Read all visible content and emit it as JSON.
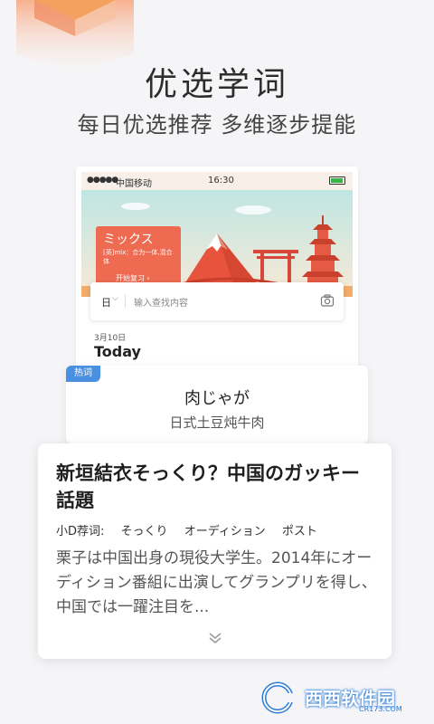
{
  "promo": {
    "headline": "优选学词",
    "subline": "每日优选推荐  多维逐步提能"
  },
  "phone": {
    "status_bar": {
      "signal": "●●●●●",
      "carrier": "中国移动",
      "time": "16:30"
    },
    "word_card": {
      "title": "ミックス",
      "definition": "[英]mix：合为一体,混合体",
      "action": "开始复习 ›"
    },
    "search": {
      "language": "日",
      "placeholder": "输入查找内容"
    },
    "date": "3月10日",
    "today": "Today"
  },
  "hot_word": {
    "tag": "热词",
    "word": "肉じゃが",
    "meaning": "日式土豆炖牛肉"
  },
  "article": {
    "title": "新垣結衣そっくり？中国のガッキー話題",
    "tags_label": "小D荐词:",
    "tags": [
      "そっくり",
      "オーディション",
      "ポスト"
    ],
    "excerpt": "栗子は中国出身の現役大学生。2014年にオーディション番組に出演してグランプリを得し、中国では一躍注目を..."
  },
  "watermark": {
    "text": "西西软件园",
    "url": "CR173.COM"
  },
  "colors": {
    "accent_red": "#ee6b52",
    "tag_blue": "#4a90e2",
    "background": "#f5f5f7"
  },
  "icons": [
    "chevron-down-icon",
    "camera-icon",
    "double-chevron-down-icon",
    "battery-icon"
  ]
}
